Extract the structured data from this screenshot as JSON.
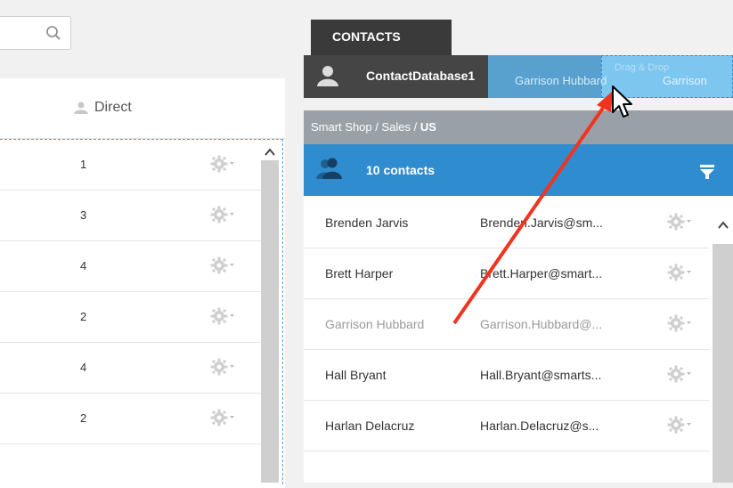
{
  "left": {
    "column_header": "Direct",
    "rows": [
      "1",
      "3",
      "4",
      "2",
      "4",
      "2"
    ]
  },
  "right": {
    "tab_label": "CONTACTS",
    "database_title": "ContactDatabase1",
    "breadcrumb_prefix": "Smart Shop / Sales / ",
    "breadcrumb_current": "US",
    "contact_count": "10 contacts",
    "drag_ghost": {
      "name": "Garrison Hubbard",
      "name_partial": "Garrison",
      "faint_text": "Drag & Drop"
    },
    "contacts": [
      {
        "name": "Brenden Jarvis",
        "email": "Brenden.Jarvis@sm...",
        "dimmed": false
      },
      {
        "name": "Brett Harper",
        "email": "Brett.Harper@smart...",
        "dimmed": false
      },
      {
        "name": "Garrison Hubbard",
        "email": "Garrison.Hubbard@...",
        "dimmed": true
      },
      {
        "name": "Hall Bryant",
        "email": "Hall.Bryant@smarts...",
        "dimmed": false
      },
      {
        "name": "Harlan Delacruz",
        "email": "Harlan.Delacruz@s...",
        "dimmed": false
      }
    ]
  },
  "colors": {
    "tab_bg": "#3a3a3a",
    "count_bar": "#2f8ccf",
    "breadcrumb_bg": "#9aa0a8",
    "drag_arrow": "#f0341e"
  },
  "icons": [
    "search-icon",
    "user-icon",
    "gear-icon",
    "filter-icon",
    "chevron-up-icon",
    "mouse-cursor-icon"
  ]
}
